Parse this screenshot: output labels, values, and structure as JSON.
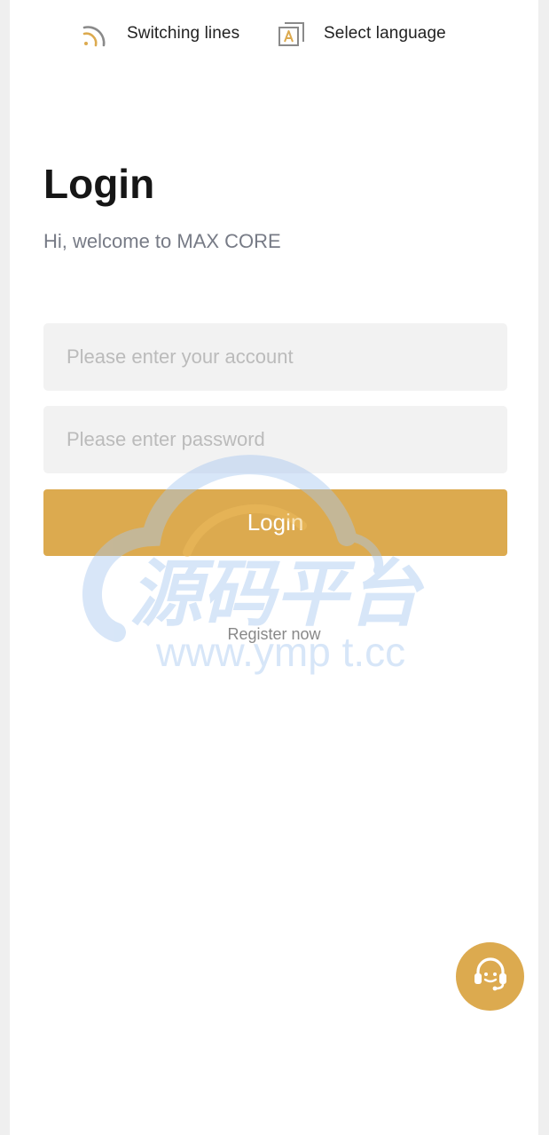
{
  "topbar": {
    "switching_lines": {
      "label": "Switching lines",
      "icon": "signal-lines-icon"
    },
    "select_language": {
      "label": "Select language",
      "icon": "language-icon"
    }
  },
  "login": {
    "title": "Login",
    "subtitle": "Hi, welcome to MAX CORE",
    "account_placeholder": "Please enter your account",
    "password_placeholder": "Please enter password",
    "login_button": "Login",
    "register_link": "Register now"
  },
  "watermark": {
    "title": "源码平台",
    "url": "www.ymp t.cc"
  },
  "support": {
    "icon": "customer-service-headset-icon"
  },
  "colors": {
    "accent": "#dcaa4f",
    "input_bg": "#f2f2f2",
    "page_bg": "#ffffff",
    "outer_bg": "#efefef",
    "watermark": "#a8c8f0"
  }
}
